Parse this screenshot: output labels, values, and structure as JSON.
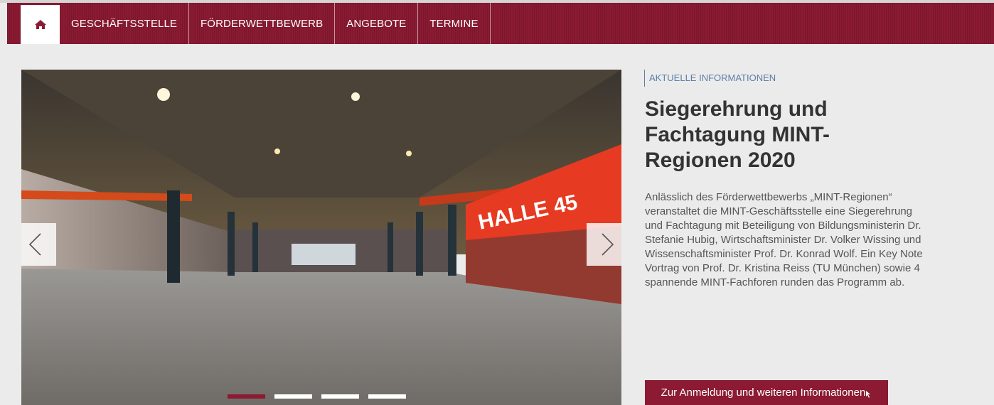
{
  "nav": {
    "home_icon": "home-icon",
    "items": [
      {
        "label": "GESCHÄFTSSTELLE"
      },
      {
        "label": "FÖRDERWETTBEWERB"
      },
      {
        "label": "ANGEBOTE"
      },
      {
        "label": "TERMINE"
      }
    ]
  },
  "slider": {
    "photo_sign": "HALLE 45",
    "prev_icon": "chevron-left-icon",
    "next_icon": "chevron-right-icon",
    "indicator_count": 4,
    "active_index": 0
  },
  "info": {
    "category": "AKTUELLE INFORMATIONEN",
    "headline": "Siegerehrung und Fachtagung MINT-Regionen 2020",
    "description": "Anlässlich des Förderwettbewerbs „MINT-Regionen“ veranstaltet die MINT-Geschäftsstelle eine Siegerehrung und Fachtagung mit Beteiligung von Bildungsministerin Dr. Stefanie Hubig, Wirtschaftsminister Dr. Volker Wissing und Wissenschaftsminister Prof. Dr. Konrad Wolf. Ein Key Note Vortrag von Prof. Dr. Kristina Reiss (TU München) sowie 4 spannende MINT-Fachforen runden das Programm ab.",
    "cta_label": "Zur Anmeldung und weiteren Informationen"
  },
  "colors": {
    "brand": "#8b1a32",
    "category_text": "#5a7fa6",
    "background": "#ebebeb"
  }
}
